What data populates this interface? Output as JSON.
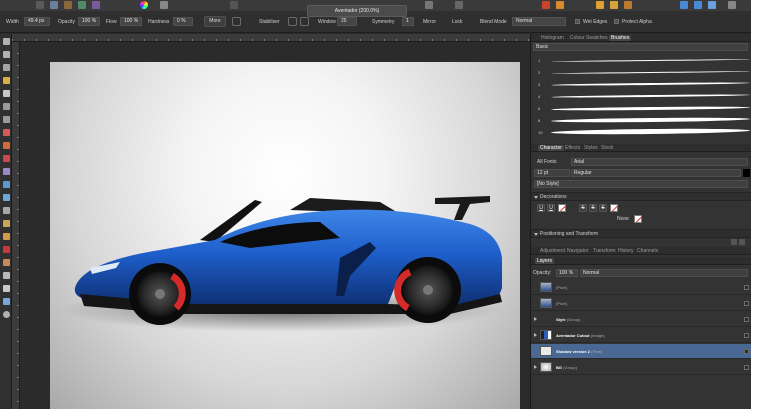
{
  "context_toolbar": {
    "width_label": "Width",
    "width_value": "49.4 px",
    "opacity_label": "Opacity",
    "opacity_value": "100 %",
    "flow_label": "Flow",
    "flow_value": "100 %",
    "hardness_label": "Hardness",
    "hardness_value": "0 %",
    "more_label": "More",
    "stabiliser_label": "Stabiliser",
    "window_label": "Window",
    "window_value": "25",
    "symmetry_label": "Symmetry",
    "symmetry_value": "1",
    "mirror_label": "Mirror",
    "lock_label": "Lock",
    "blend_mode_label": "Blend Mode",
    "blend_mode_value": "Normal",
    "wet_edges_label": "Wet Edges",
    "protect_alpha_label": "Protect Alpha"
  },
  "document": {
    "title": "Aventador (200.0%)"
  },
  "brushes_panel": {
    "tabs": [
      "Histogram",
      "Colour",
      "Swatches",
      "Brushes"
    ],
    "active_tab": "Brushes",
    "category": "Basic",
    "brush_sizes": [
      "1",
      "2",
      "3",
      "4",
      "6",
      "8",
      "10"
    ]
  },
  "character_panel": {
    "tabs": [
      "Character",
      "Effects",
      "Styles",
      "Stock"
    ],
    "active_tab": "Character",
    "font_collection": "All Fonts",
    "font_family": "Arial",
    "font_size": "12 pt",
    "font_style": "Regular",
    "text_style": "[No Style]",
    "decorations_title": "Decorations",
    "decoration_buttons": [
      "U",
      "U",
      "S",
      "S",
      "S"
    ],
    "decoration_value": "None",
    "positioning_title": "Positioning and Transform"
  },
  "layers_panel": {
    "tabs": [
      "Adjustment",
      "Navigator",
      "Transform",
      "History",
      "Channels"
    ],
    "title": "Layers",
    "opacity_label": "Opacity:",
    "opacity_value": "100 %",
    "blend_value": "Normal",
    "layers": [
      {
        "name": "",
        "type": "(Pixel)",
        "selected": false
      },
      {
        "name": "",
        "type": "(Pixel)",
        "selected": false
      },
      {
        "name": "Style",
        "type": "(Group)",
        "selected": false
      },
      {
        "name": "Aventador Cutout",
        "type": "(Image)",
        "selected": false
      },
      {
        "name": "Shadow version 2",
        "type": "(Pixel)",
        "selected": true
      },
      {
        "name": "BG",
        "type": "(Group)",
        "selected": false
      }
    ]
  },
  "colors": {
    "selection_blue": "#4a6894",
    "car_blue": "#1f5fc8",
    "brake_red": "#d42a2a"
  }
}
